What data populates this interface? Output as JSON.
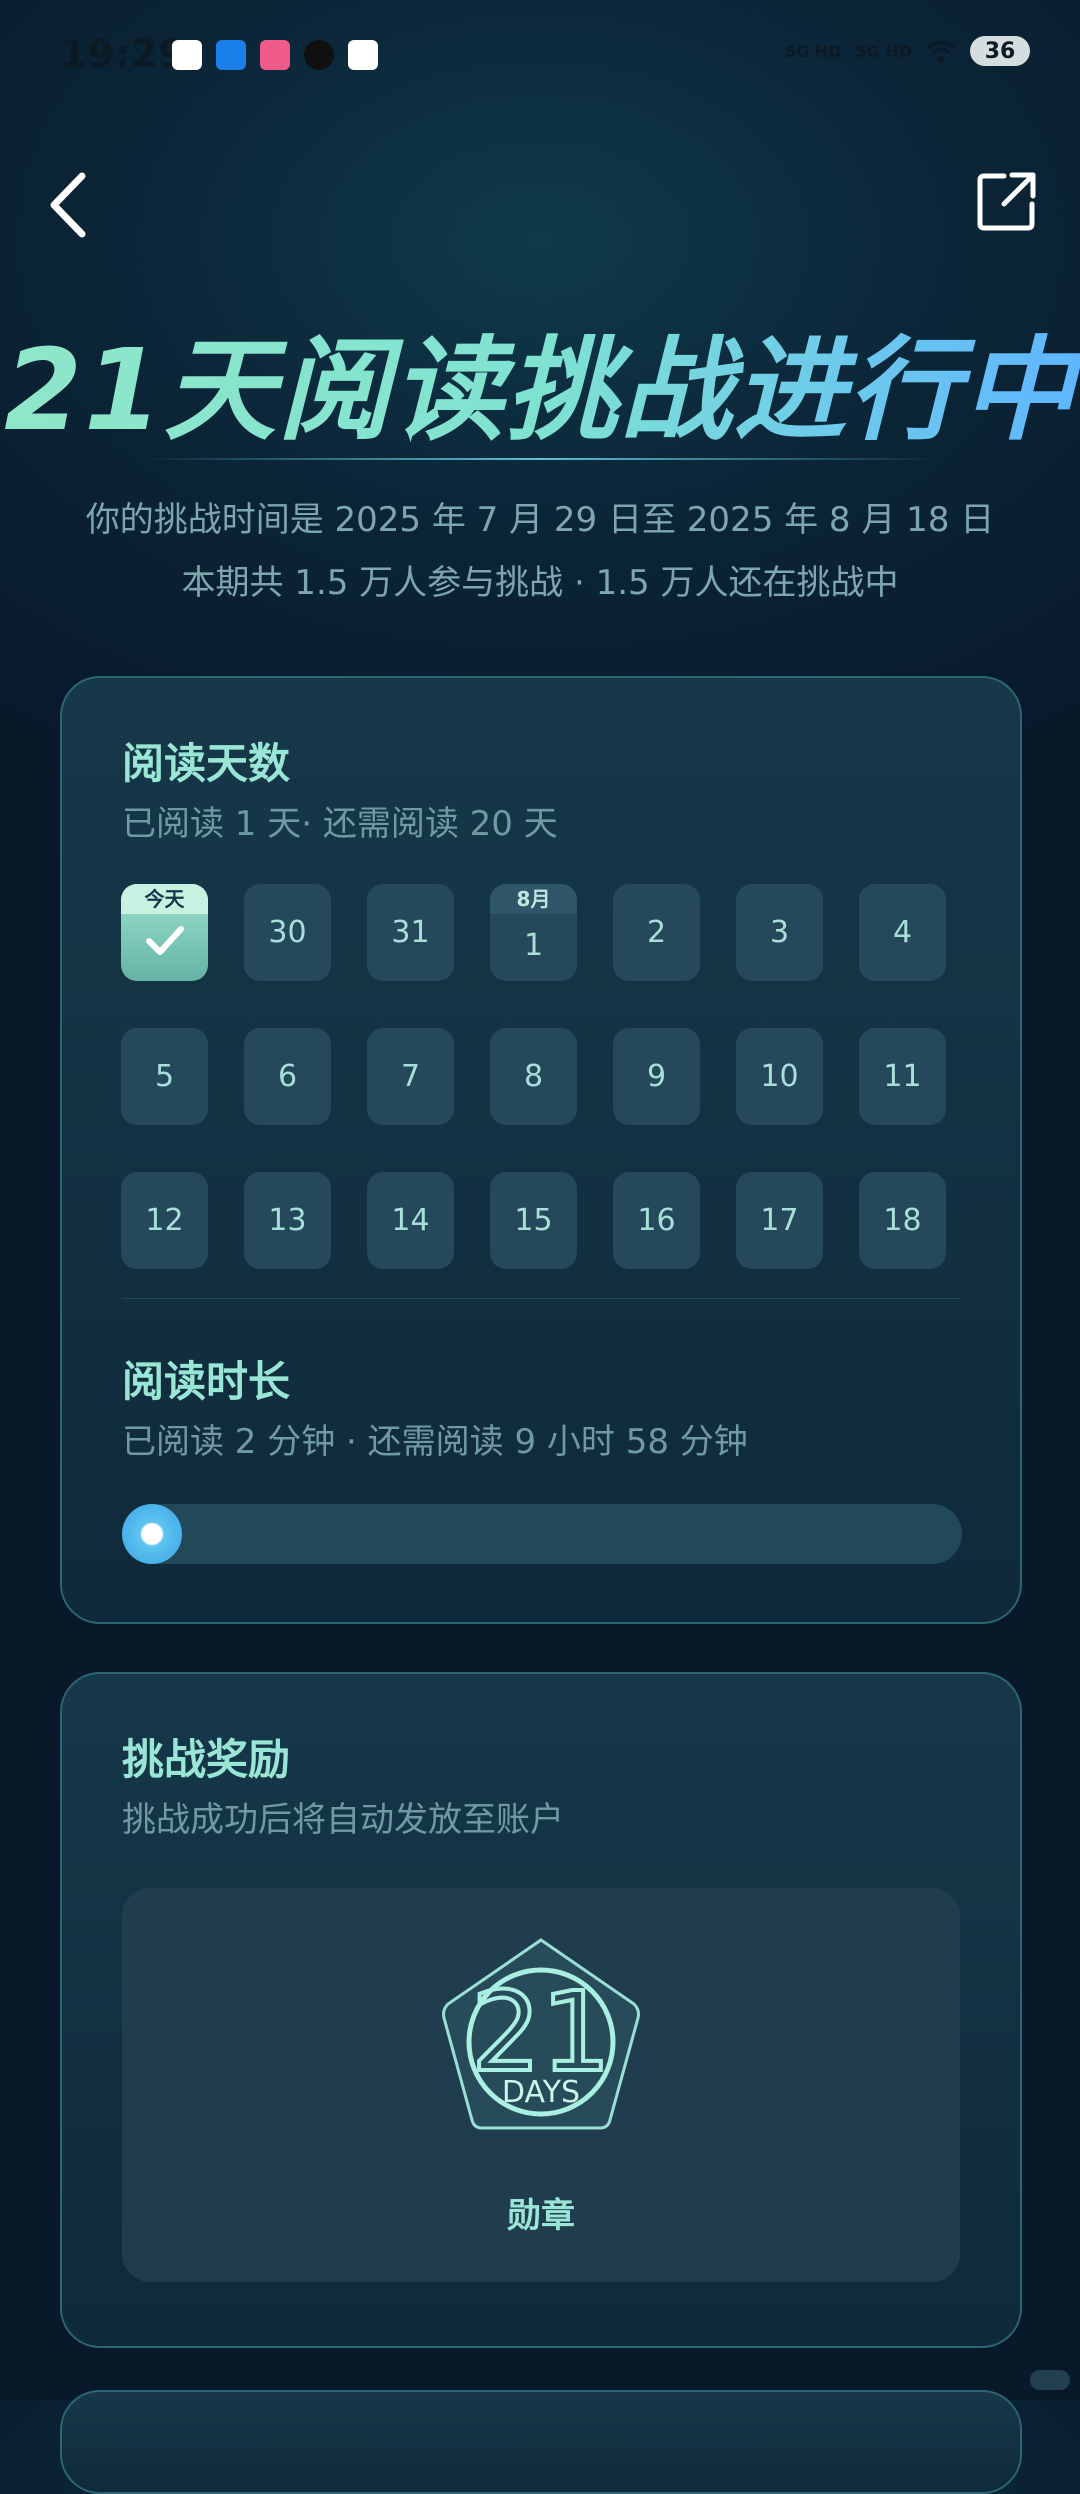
{
  "status_bar": {
    "time": "19:29",
    "signal1": "5G HD",
    "signal2": "5G HD",
    "battery": "36"
  },
  "nav": {
    "back_icon": "chevron-left-icon",
    "share_icon": "share-icon"
  },
  "hero": {
    "title": "21天阅读挑战进行中",
    "subtitle1": "你的挑战时间是 2025 年 7 月 29 日至 2025 年 8 月 18 日",
    "subtitle2": "本期共 1.5 万人参与挑战 · 1.5 万人还在挑战中"
  },
  "reading_days": {
    "title": "阅读天数",
    "subtitle": "已阅读 1 天· 还需阅读 20 天",
    "today_label": "今天",
    "month_label": "8月",
    "rows": [
      [
        "今天",
        "30",
        "31",
        "1",
        "2",
        "3",
        "4"
      ],
      [
        "5",
        "6",
        "7",
        "8",
        "9",
        "10",
        "11"
      ],
      [
        "12",
        "13",
        "14",
        "15",
        "16",
        "17",
        "18"
      ]
    ]
  },
  "reading_time": {
    "title": "阅读时长",
    "subtitle": "已阅读 2 分钟 · 还需阅读 9 小时 58 分钟",
    "progress_fraction": 0.003
  },
  "reward": {
    "title": "挑战奖励",
    "subtitle": "挑战成功后将自动发放至账户",
    "badge_number": "21",
    "badge_text": "DAYS",
    "badge_label": "勋章"
  },
  "colors": {
    "accent": "#9ae6d6",
    "background": "#0b2638",
    "card": "#163849"
  }
}
